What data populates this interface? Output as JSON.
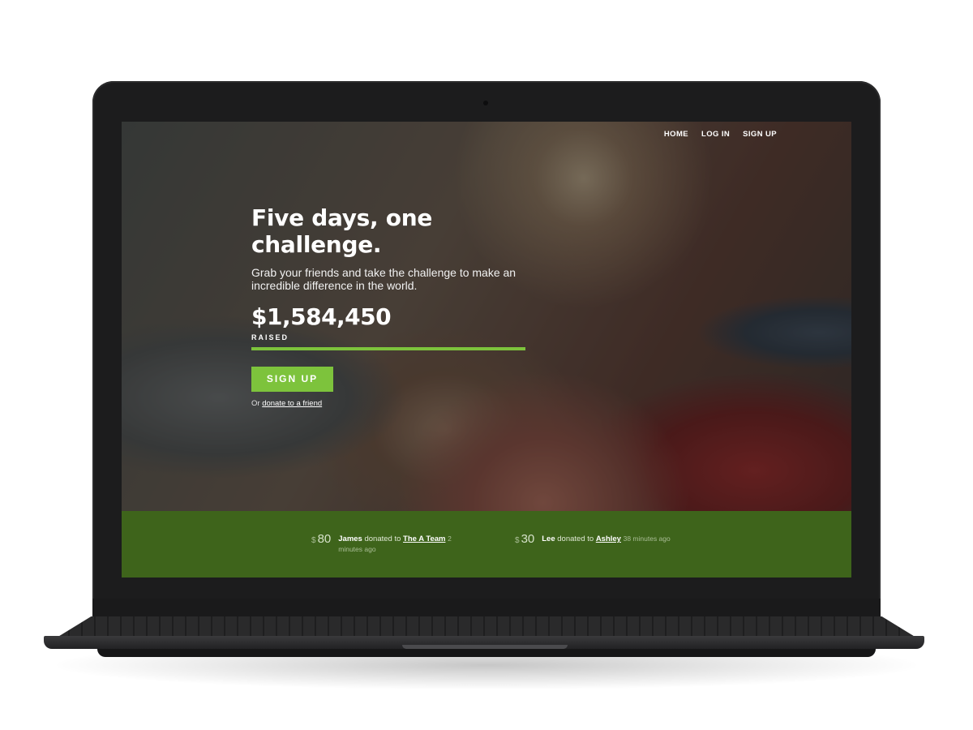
{
  "nav": {
    "items": [
      {
        "label": "HOME"
      },
      {
        "label": "LOG IN"
      },
      {
        "label": "SIGN UP"
      }
    ]
  },
  "hero": {
    "headline": "Five days, one challenge.",
    "subtext": "Grab your friends and take the challenge to make an incredible difference in the world.",
    "amount": "$1,584,450",
    "amount_label": "RAISED",
    "progress_fraction": 1.0,
    "signup_label": "SIGN UP",
    "alt_prefix": "Or",
    "alt_link": "donate to a friend"
  },
  "feed": {
    "donations": [
      {
        "currency": "$",
        "amount": "80",
        "donor": "James",
        "verb": "donated to",
        "recipient": "The A Team",
        "ago": "2 minutes ago"
      },
      {
        "currency": "$",
        "amount": "30",
        "donor": "Lee",
        "verb": "donated to",
        "recipient": "Ashley",
        "ago": "38 minutes ago"
      }
    ]
  },
  "colors": {
    "accent": "#7dc33c",
    "feed_background": "#3e641b"
  }
}
